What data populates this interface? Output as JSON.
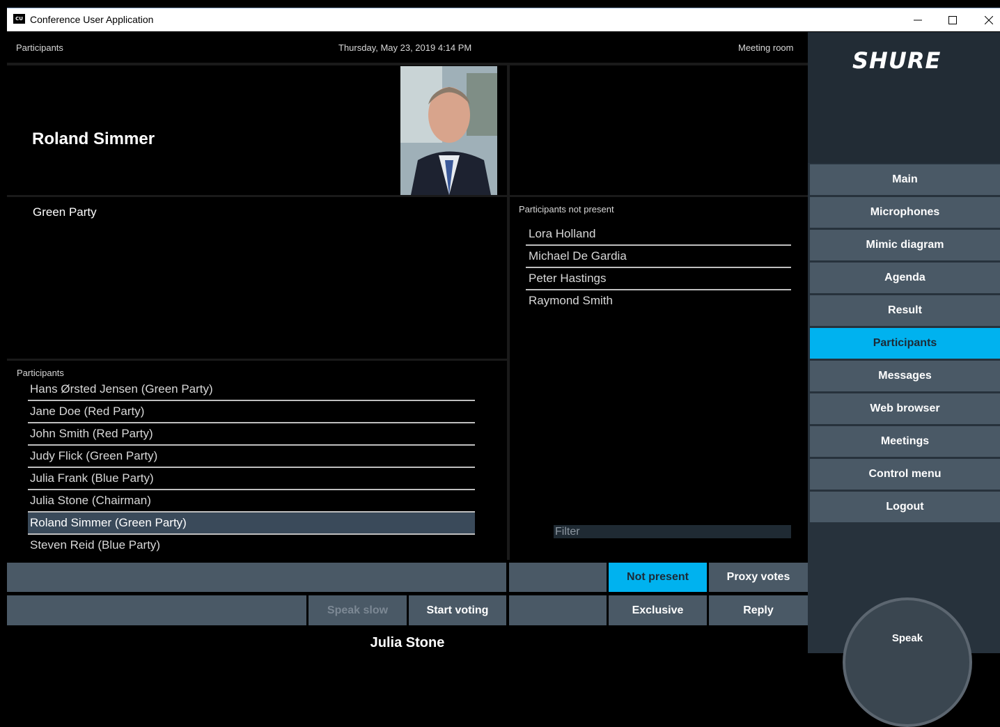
{
  "window": {
    "title": "Conference User Application",
    "icon_text": "CU",
    "controls": [
      "minimize-icon",
      "maximize-icon",
      "close-icon"
    ]
  },
  "header": {
    "left": "Participants",
    "center": "Thursday, May 23, 2019 4:14 PM",
    "right": "Meeting room"
  },
  "speaker": {
    "name": "Roland  Simmer",
    "party": "Green Party"
  },
  "not_present": {
    "title": "Participants not present",
    "items": [
      "Lora Holland",
      "Michael De Gardia",
      "Peter Hastings",
      "Raymond Smith"
    ],
    "filter_placeholder": "Filter"
  },
  "participants": {
    "title": "Participants",
    "items": [
      "Hans Ørsted Jensen  (Green Party)",
      "Jane Doe  (Red Party)",
      "John Smith (Red Party)",
      "Judy Flick (Green Party)",
      "Julia Frank (Blue Party)",
      "Julia Stone (Chairman)",
      "Roland  Simmer (Green Party)",
      "Steven Reid (Blue Party)"
    ],
    "selected_index": 6
  },
  "buttons": {
    "not_present": "Not present",
    "proxy_votes": "Proxy votes",
    "speak_slow": "Speak slow",
    "start_voting": "Start voting",
    "exclusive": "Exclusive",
    "reply": "Reply"
  },
  "footer": {
    "chairman": "Julia Stone"
  },
  "sidebar": {
    "brand": "SHURE",
    "nav": [
      "Main",
      "Microphones",
      "Mimic diagram",
      "Agenda",
      "Result",
      "Participants",
      "Messages",
      "Web browser",
      "Meetings",
      "Control menu",
      "Logout"
    ],
    "active": "Participants",
    "speak": "Speak"
  },
  "colors": {
    "accent": "#00b2ef",
    "button": "#4a5966",
    "sidebar": "#27323c"
  }
}
